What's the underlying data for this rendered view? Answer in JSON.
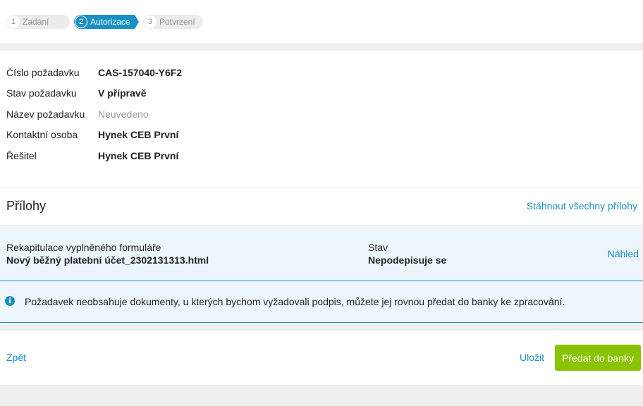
{
  "stepper": {
    "steps": [
      {
        "number": "1",
        "label": "Zadání",
        "state": "inactive"
      },
      {
        "number": "2",
        "label": "Autorizace",
        "state": "active"
      },
      {
        "number": "3",
        "label": "Potvrzení",
        "state": "inactive"
      }
    ],
    "active_color": "#1a8fc4"
  },
  "details": {
    "rows": [
      {
        "label": "Číslo požadavku",
        "value": "CAS-157040-Y6F2"
      },
      {
        "label": "Stav požadavku",
        "value": "V přípravě"
      },
      {
        "label": "Název požadavku",
        "value": "Neuvedeno"
      },
      {
        "label": "Kontaktní osoba",
        "value": "Hynek CEB První"
      },
      {
        "label": "Řešitel",
        "value": "Hynek CEB První"
      }
    ]
  },
  "attachments": {
    "title": "Přílohy",
    "download_all": "Stáhnout všechny přílohy",
    "items": [
      {
        "name_label": "Rekapitulace vyplněného formuláře",
        "name": "Nový běžný platební účet_2302131313.html",
        "status_label": "Stav",
        "status": "Nepodepisuje se",
        "preview": "Náhled"
      }
    ]
  },
  "info": {
    "icon": "info-icon",
    "glyph": "i",
    "text": "Požadavek neobsahuje dokumenty, u kterých bychom vyžadovali podpis, můžete jej rovnou předat do banky ke zpracování."
  },
  "actions": {
    "back": "Zpět",
    "save": "Uložit",
    "submit": "Předat do banky",
    "submit_color": "#8ac300"
  }
}
